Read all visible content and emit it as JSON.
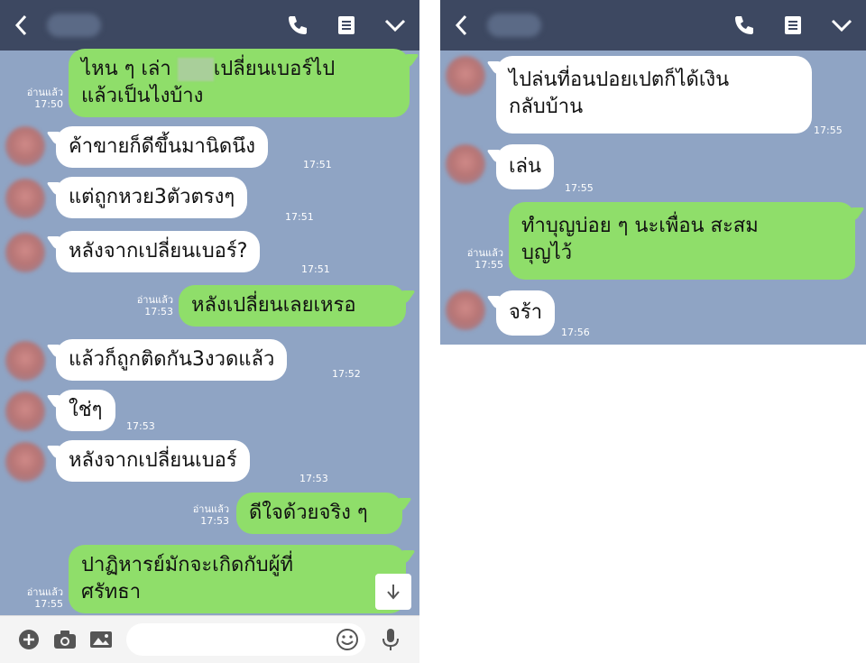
{
  "colors": {
    "header_bg": "#3d4861",
    "chat_bg": "#8fa4c4",
    "outgoing_bubble": "#8fde6a",
    "incoming_bubble": "#ffffff"
  },
  "icons": {
    "back": "chevron-left-icon",
    "call": "phone-icon",
    "notes": "notes-icon",
    "menu": "chevron-down-icon",
    "add": "plus-icon",
    "camera": "camera-icon",
    "image": "image-icon",
    "emoji": "emoji-icon",
    "mic": "mic-icon",
    "scroll_down": "arrow-down-icon"
  },
  "left_chat": {
    "messages": [
      {
        "dir": "out",
        "text_a": "ไหน ๆ เล่า",
        "text_b": "เปลี่ยนเบอร์ไป",
        "text_c": "แล้วเป็นไงบ้าง",
        "read": "อ่านแล้ว",
        "time": "17:50"
      },
      {
        "dir": "in",
        "text": "ค้าขายก็ดีขึ้นมานิดนึง",
        "time": "17:51"
      },
      {
        "dir": "in",
        "text": "แต่ถูกหวย3ตัวตรงๆ",
        "time": "17:51"
      },
      {
        "dir": "in",
        "text": "หลังจากเปลี่ยนเบอร์?",
        "time": "17:51"
      },
      {
        "dir": "out",
        "text": "หลังเปลี่ยนเลยเหรอ",
        "read": "อ่านแล้ว",
        "time": "17:53"
      },
      {
        "dir": "in",
        "text": "แล้วก็ถูกติดกัน3งวดแล้ว",
        "time": "17:52"
      },
      {
        "dir": "in",
        "text": "ใช่ๆ",
        "time": "17:53"
      },
      {
        "dir": "in",
        "text": "หลังจากเปลี่ยนเบอร์",
        "time": "17:53"
      },
      {
        "dir": "out",
        "text": "ดีใจด้วยจริง ๆ",
        "read": "อ่านแล้ว",
        "time": "17:53"
      },
      {
        "dir": "out",
        "text_a": "ปาฏิหารย์มักจะเกิดกับผู้ที่",
        "text_b": "ศรัทธา",
        "read": "อ่านแล้ว",
        "time": "17:55"
      }
    ]
  },
  "right_chat": {
    "messages": [
      {
        "dir": "in",
        "text_a": "ไปล่นที่อนปอยเปตก็ได้เงิน",
        "text_b": "กลับบ้าน",
        "time": "17:55"
      },
      {
        "dir": "in",
        "text": "เล่น",
        "time": "17:55"
      },
      {
        "dir": "out",
        "text_a": "ทำบุญบ่อย ๆ นะเพื่อน  สะสม",
        "text_b": "บุญไว้",
        "read": "อ่านแล้ว",
        "time": "17:55"
      },
      {
        "dir": "in",
        "text": "จร้า",
        "time": "17:56"
      }
    ]
  }
}
